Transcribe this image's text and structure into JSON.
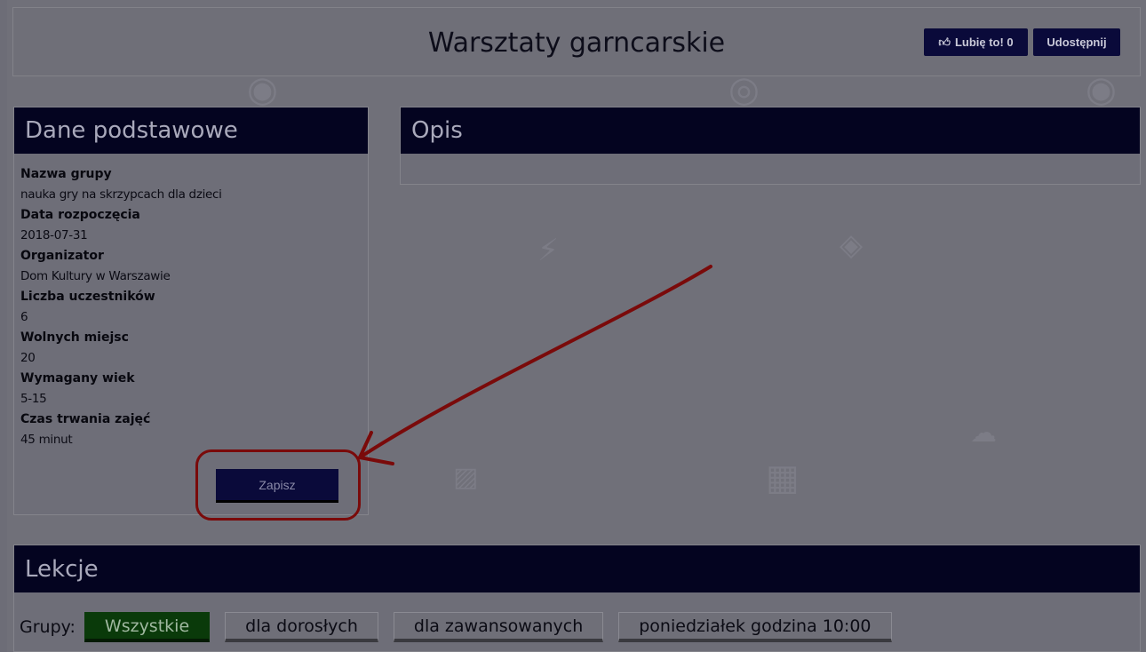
{
  "header": {
    "title": "Warsztaty garncarskie",
    "like_label": "Lubię to! 0",
    "share_label": "Udostępnij"
  },
  "basic_panel": {
    "title": "Dane podstawowe",
    "fields": [
      {
        "label": "Nazwa grupy",
        "value": "nauka gry na skrzypcach dla dzieci"
      },
      {
        "label": "Data rozpoczęcia",
        "value": "2018-07-31"
      },
      {
        "label": "Organizator",
        "value": "Dom Kultury w Warszawie"
      },
      {
        "label": "Liczba uczestników",
        "value": "6"
      },
      {
        "label": "Wolnych miejsc",
        "value": "20"
      },
      {
        "label": "Wymagany wiek",
        "value": "5-15"
      },
      {
        "label": "Czas trwania zajęć",
        "value": "45 minut"
      }
    ],
    "signup_label": "Zapisz"
  },
  "description_panel": {
    "title": "Opis"
  },
  "lessons_panel": {
    "title": "Lekcje",
    "groups_label": "Grupy:",
    "groups": [
      {
        "label": "Wszystkie",
        "active": true
      },
      {
        "label": "dla dorosłych",
        "active": false
      },
      {
        "label": "dla zawansowanych",
        "active": false
      },
      {
        "label": "poniedziałek godzina 10:00",
        "active": false
      }
    ]
  },
  "colors": {
    "overlay": "#6d6d77",
    "panel_header": "#040420",
    "button": "#0a0a3a",
    "active_chip": "#0a3a0a",
    "annotation": "#7a0a0a"
  }
}
